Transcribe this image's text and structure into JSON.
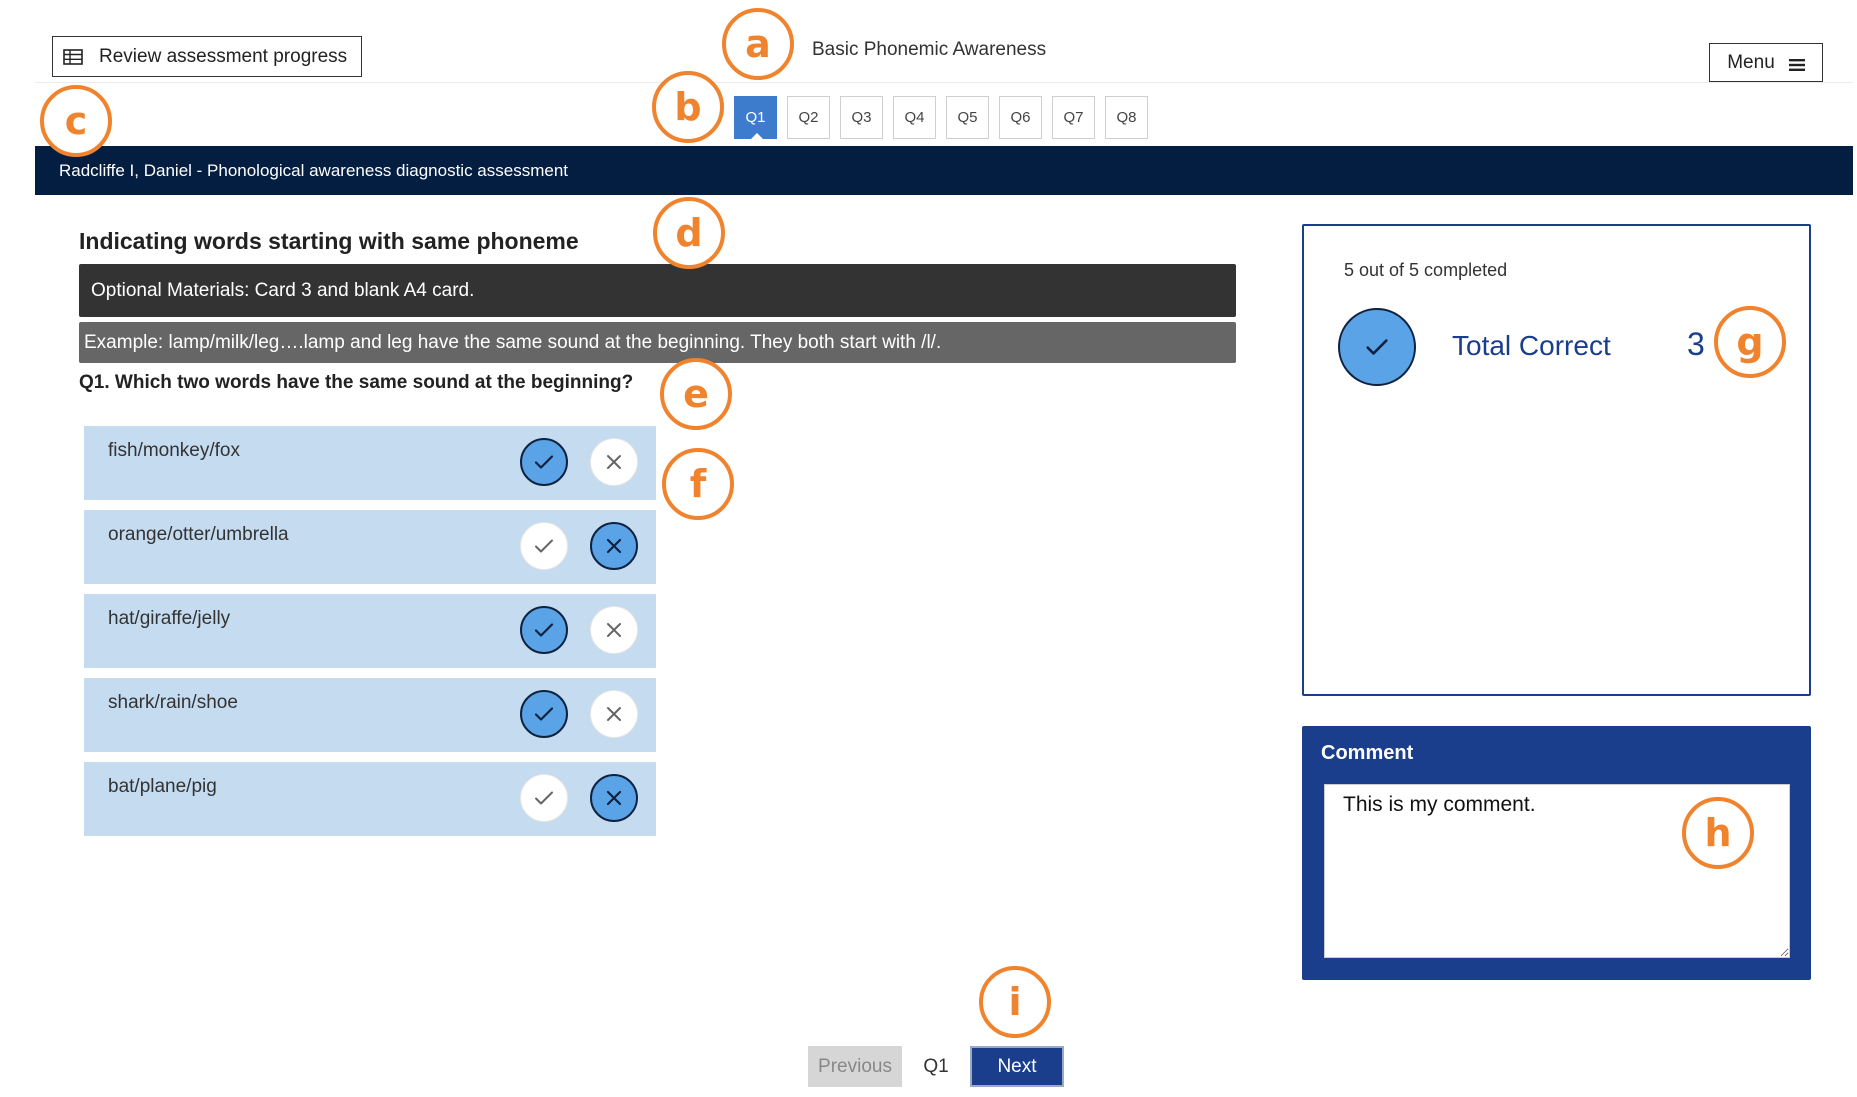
{
  "header": {
    "review_label": "Review assessment progress",
    "app_title": "Basic Phonemic Awareness",
    "menu_label": "Menu"
  },
  "question_tabs": [
    {
      "label": "Q1",
      "active": true
    },
    {
      "label": "Q2",
      "active": false
    },
    {
      "label": "Q3",
      "active": false
    },
    {
      "label": "Q4",
      "active": false
    },
    {
      "label": "Q5",
      "active": false
    },
    {
      "label": "Q6",
      "active": false
    },
    {
      "label": "Q7",
      "active": false
    },
    {
      "label": "Q8",
      "active": false
    }
  ],
  "student_bar": "Radcliffe I, Daniel - Phonological awareness diagnostic assessment",
  "main": {
    "heading": "Indicating words starting with same phoneme",
    "materials": "Optional Materials: Card 3 and blank A4 card.",
    "example": "Example: lamp/milk/leg….lamp and leg have the same sound at the beginning. They both start with /l/.",
    "prompt": "Q1. Which two words have the same sound at the beginning?",
    "items": [
      {
        "label": "fish/monkey/fox",
        "answer": "correct"
      },
      {
        "label": "orange/otter/umbrella",
        "answer": "incorrect"
      },
      {
        "label": "hat/giraffe/jelly",
        "answer": "correct"
      },
      {
        "label": "shark/rain/shoe",
        "answer": "correct"
      },
      {
        "label": "bat/plane/pig",
        "answer": "incorrect"
      }
    ]
  },
  "score": {
    "completed_text": "5 out of 5 completed",
    "total_label": "Total Correct",
    "total_value": "3"
  },
  "comment": {
    "title": "Comment",
    "value": "This is my comment."
  },
  "pager": {
    "previous_label": "Previous",
    "current": "Q1",
    "next_label": "Next"
  },
  "callouts": [
    "a",
    "b",
    "c",
    "d",
    "e",
    "f",
    "g",
    "h",
    "i"
  ],
  "colors": {
    "navy": "#041e42",
    "brand_blue": "#1a3d8c",
    "selected_blue": "#5aa3e6",
    "row_blue": "#c5dbf0",
    "callout_orange": "#f0832d"
  }
}
